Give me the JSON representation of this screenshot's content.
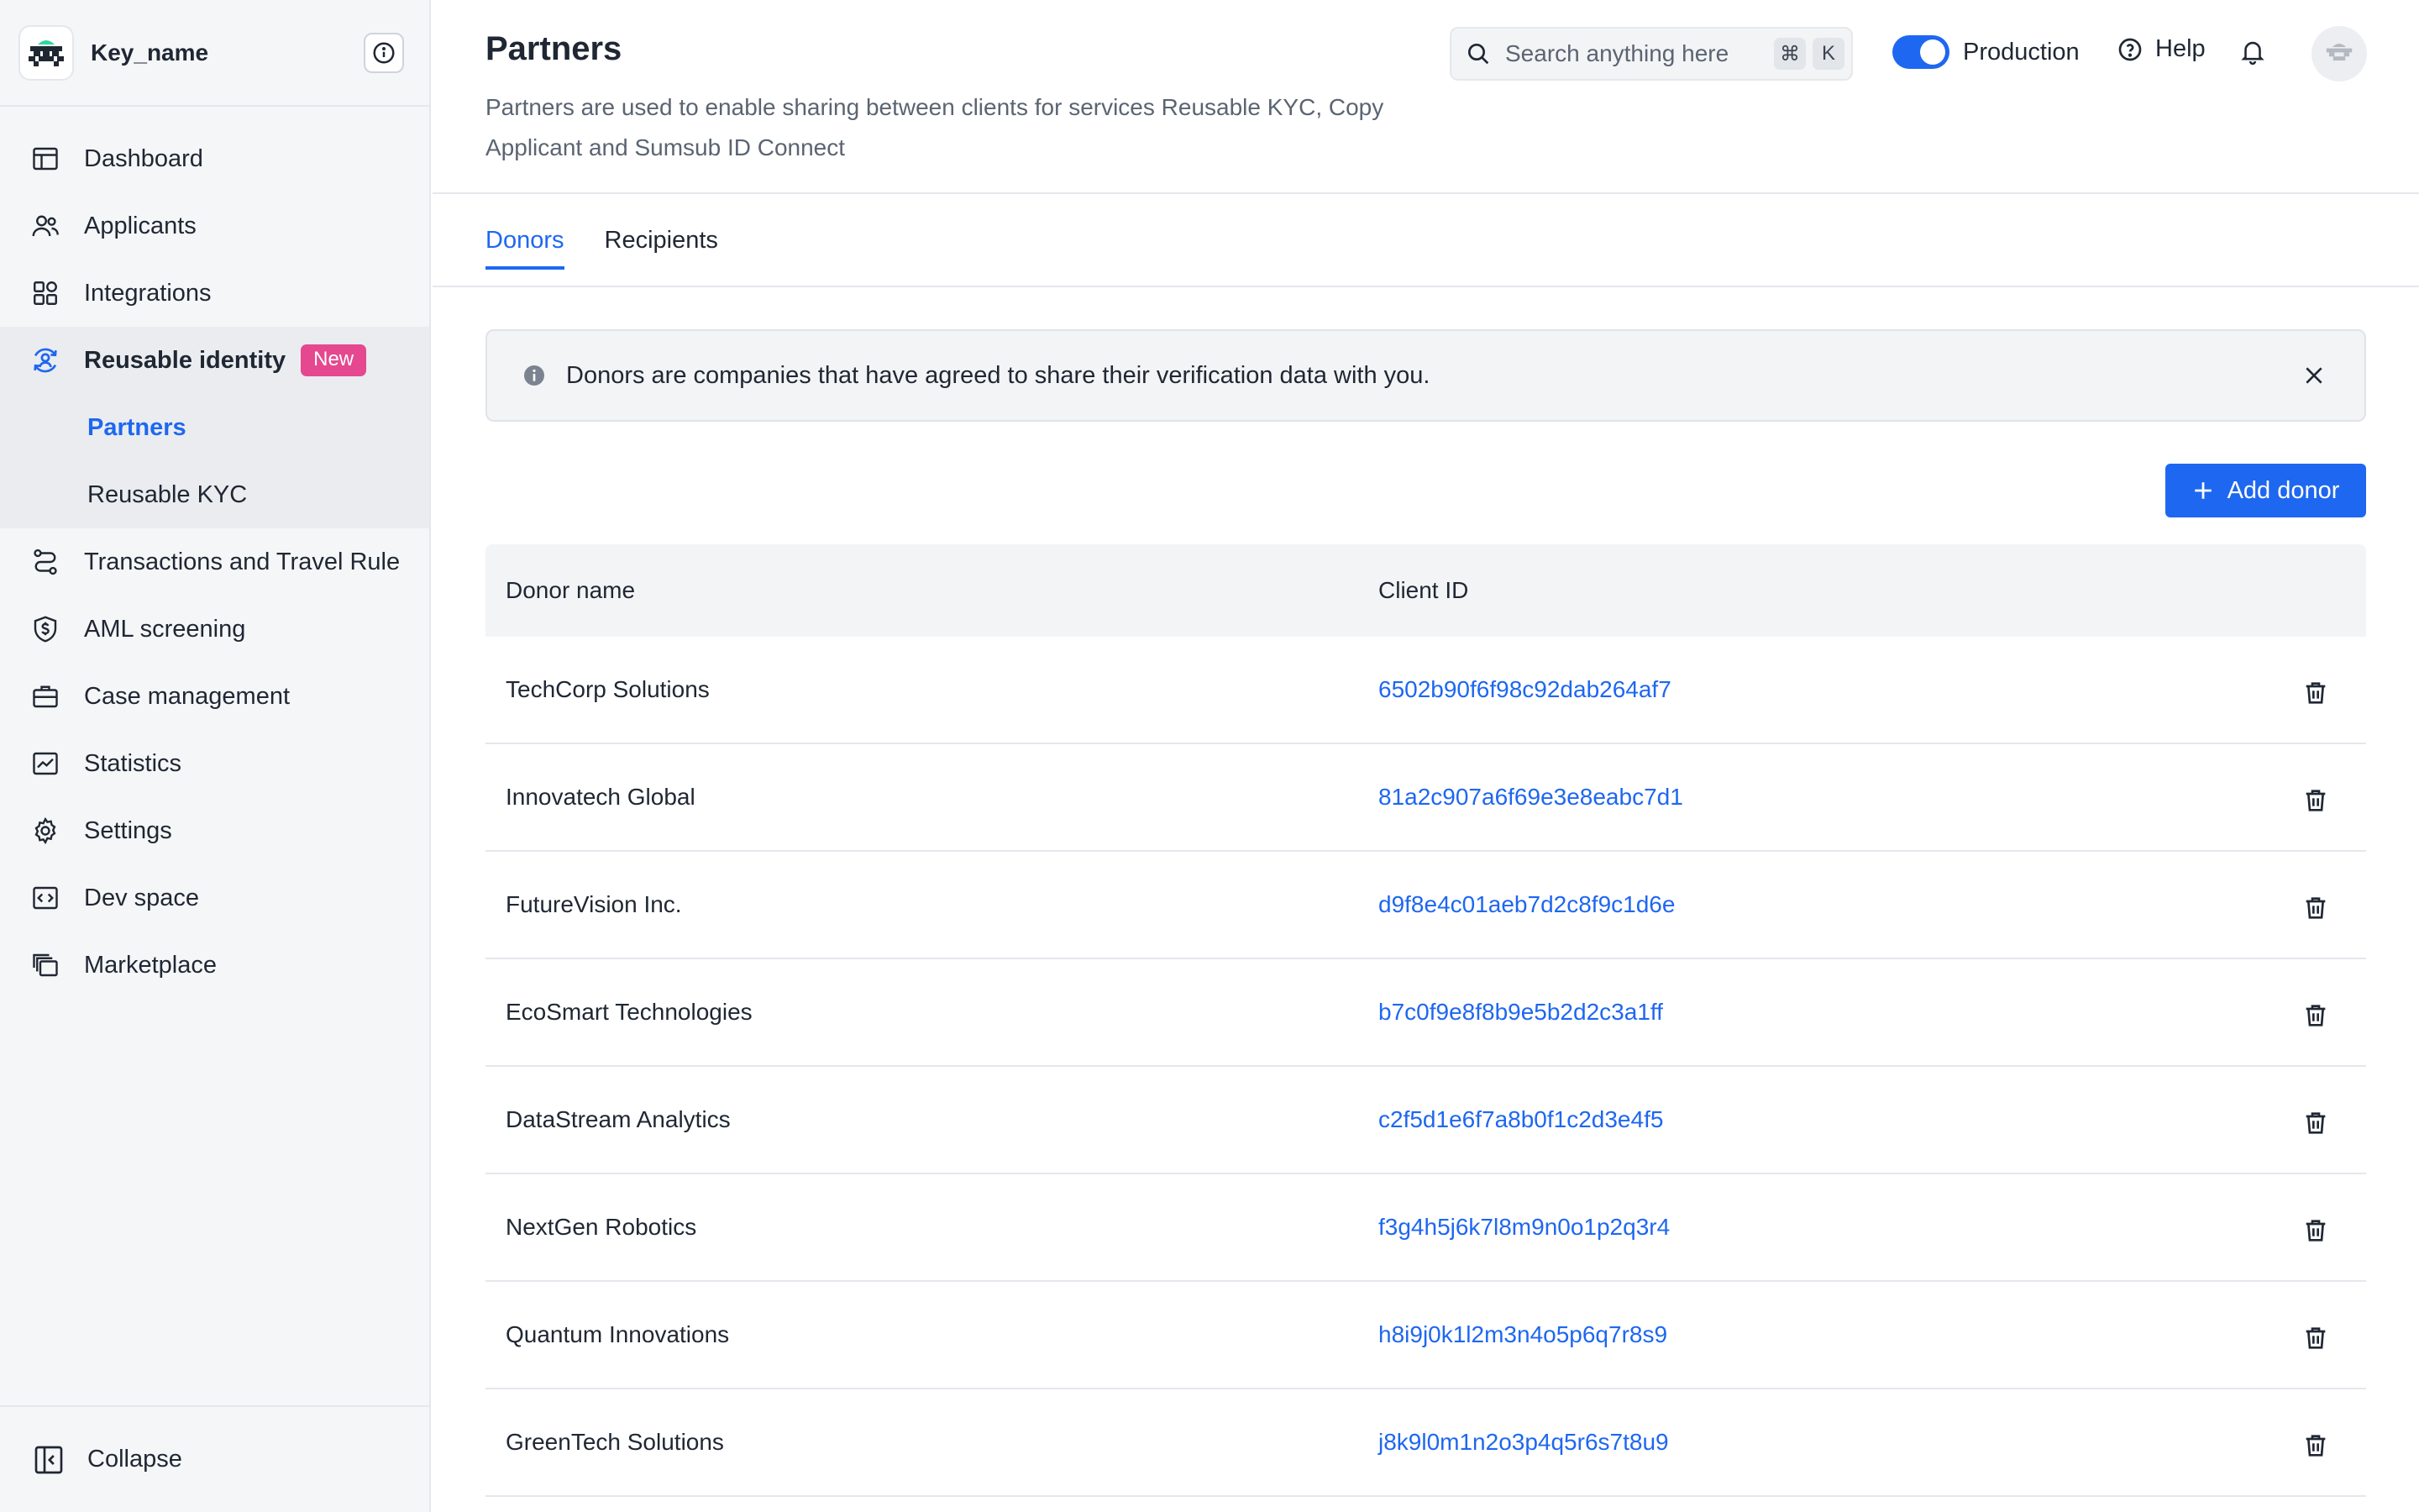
{
  "brand": {
    "name": "Key_name"
  },
  "sidebar": {
    "items": [
      {
        "label": "Dashboard",
        "icon": "dashboard-icon"
      },
      {
        "label": "Applicants",
        "icon": "users-icon"
      },
      {
        "label": "Integrations",
        "icon": "integrations-icon"
      }
    ],
    "group": {
      "label": "Reusable identity",
      "badge": "New",
      "icon": "reusable-identity-icon",
      "children": [
        {
          "label": "Partners",
          "active": true
        },
        {
          "label": "Reusable KYC",
          "active": false
        }
      ]
    },
    "items_after": [
      {
        "label": "Transactions and Travel Rule",
        "icon": "transactions-icon"
      },
      {
        "label": "AML screening",
        "icon": "aml-shield-icon"
      },
      {
        "label": "Case management",
        "icon": "briefcase-icon"
      },
      {
        "label": "Statistics",
        "icon": "chart-icon"
      },
      {
        "label": "Settings",
        "icon": "gear-icon"
      },
      {
        "label": "Dev space",
        "icon": "code-icon"
      },
      {
        "label": "Marketplace",
        "icon": "marketplace-icon"
      }
    ],
    "collapse_label": "Collapse"
  },
  "header": {
    "title": "Partners",
    "description": "Partners are used to enable sharing between clients for services Reusable KYC, Copy Applicant and Sumsub ID Connect",
    "search_placeholder": "Search anything here",
    "shortcut": {
      "mod": "⌘",
      "key": "K"
    },
    "environment_label": "Production",
    "environment_on": true,
    "help_label": "Help"
  },
  "tabs": [
    {
      "label": "Donors",
      "active": true
    },
    {
      "label": "Recipients",
      "active": false
    }
  ],
  "banner": {
    "text": "Donors are companies that have agreed to share their verification data with you."
  },
  "add_button_label": "Add donor",
  "table": {
    "columns": [
      "Donor name",
      "Client ID"
    ],
    "rows": [
      {
        "name": "TechCorp Solutions",
        "client_id": "6502b90f6f98c92dab264af7"
      },
      {
        "name": "Innovatech Global",
        "client_id": "81a2c907a6f69e3e8eabc7d1"
      },
      {
        "name": "FutureVision Inc.",
        "client_id": "d9f8e4c01aeb7d2c8f9c1d6e"
      },
      {
        "name": "EcoSmart Technologies",
        "client_id": "b7c0f9e8f8b9e5b2d2c3a1ff"
      },
      {
        "name": "DataStream Analytics",
        "client_id": "c2f5d1e6f7a8b0f1c2d3e4f5"
      },
      {
        "name": "NextGen Robotics",
        "client_id": "f3g4h5j6k7l8m9n0o1p2q3r4"
      },
      {
        "name": "Quantum Innovations",
        "client_id": "h8i9j0k1l2m3n4o5p6q7r8s9"
      },
      {
        "name": "GreenTech Solutions",
        "client_id": "j8k9l0m1n2o3p4q5r6s7t8u9"
      }
    ]
  },
  "colors": {
    "accent": "#1e67f0",
    "badge": "#e5488f",
    "sidebar_bg": "#f5f6f8",
    "text": "#1f2733"
  }
}
